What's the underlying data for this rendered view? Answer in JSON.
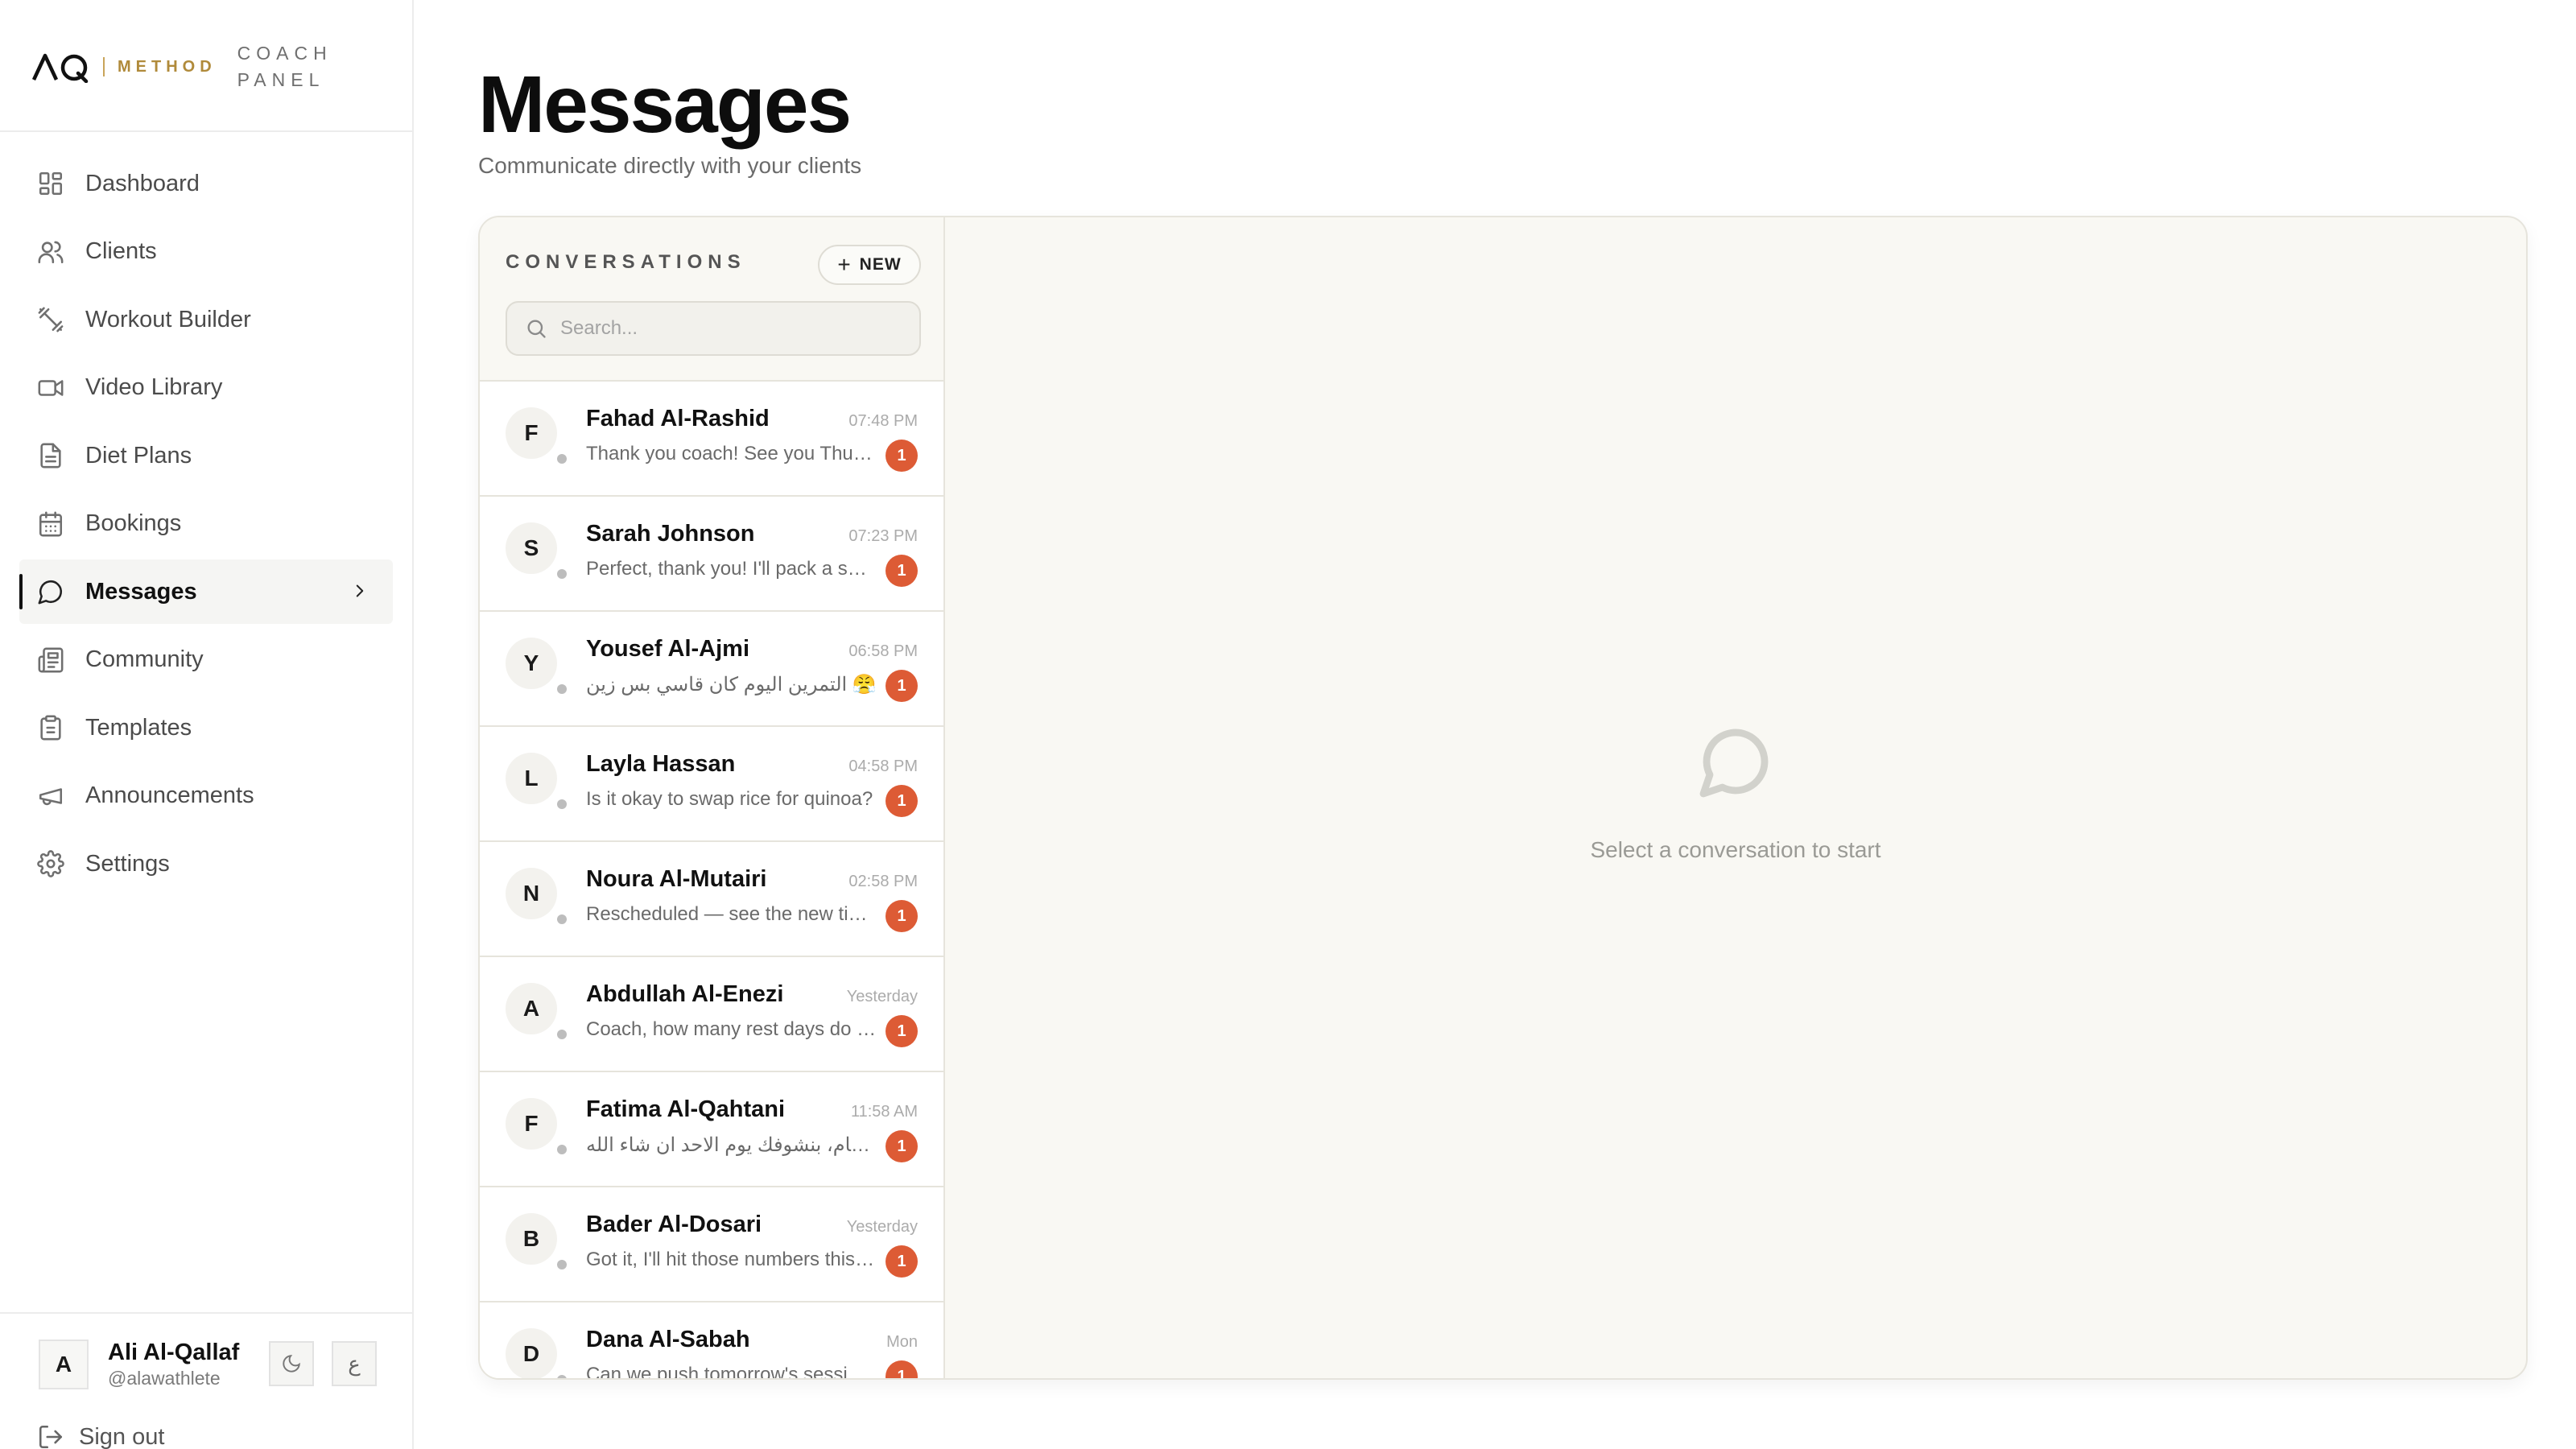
{
  "brand": {
    "logo": "AQ",
    "method": "METHOD",
    "panel": "COACH PANEL"
  },
  "nav": {
    "items": [
      {
        "label": "Dashboard",
        "icon": "dashboard-icon"
      },
      {
        "label": "Clients",
        "icon": "users-icon"
      },
      {
        "label": "Workout Builder",
        "icon": "dumbbell-icon"
      },
      {
        "label": "Video Library",
        "icon": "video-icon"
      },
      {
        "label": "Diet Plans",
        "icon": "file-text-icon"
      },
      {
        "label": "Bookings",
        "icon": "calendar-icon"
      },
      {
        "label": "Messages",
        "icon": "message-icon",
        "active": true
      },
      {
        "label": "Community",
        "icon": "newspaper-icon"
      },
      {
        "label": "Templates",
        "icon": "clipboard-icon"
      },
      {
        "label": "Announcements",
        "icon": "megaphone-icon"
      },
      {
        "label": "Settings",
        "icon": "gear-icon"
      }
    ]
  },
  "user": {
    "initial": "A",
    "name": "Ali Al-Qallaf",
    "handle": "@alawathlete",
    "theme_icon": "moon-icon",
    "lang_label": "ع"
  },
  "signout": {
    "label": "Sign out"
  },
  "page": {
    "title": "Messages",
    "subtitle": "Communicate directly with your clients"
  },
  "conversations": {
    "heading": "CONVERSATIONS",
    "new_label": "NEW",
    "search_placeholder": "Search...",
    "items": [
      {
        "initial": "F",
        "name": "Fahad Al-Rashid",
        "time": "07:48 PM",
        "preview": "Thank you coach! See you Thursday.",
        "unread": "1"
      },
      {
        "initial": "S",
        "name": "Sarah Johnson",
        "time": "07:23 PM",
        "preview": "Perfect, thank you! I'll pack a snack.",
        "unread": "1"
      },
      {
        "initial": "Y",
        "name": "Yousef Al-Ajmi",
        "time": "06:58 PM",
        "preview": "التمرين اليوم كان قاسي بس زين 😤",
        "unread": "1"
      },
      {
        "initial": "L",
        "name": "Layla Hassan",
        "time": "04:58 PM",
        "preview": "Is it okay to swap rice for quinoa?",
        "unread": "1"
      },
      {
        "initial": "N",
        "name": "Noura Al-Mutairi",
        "time": "02:58 PM",
        "preview": "Rescheduled — see the new time.",
        "unread": "1"
      },
      {
        "initial": "A",
        "name": "Abdullah Al-Enezi",
        "time": "Yesterday",
        "preview": "Coach, how many rest days do I need?",
        "unread": "1"
      },
      {
        "initial": "F",
        "name": "Fatima Al-Qahtani",
        "time": "11:58 AM",
        "preview": "ماشي تمام، بنشوفك يوم الاحد ان شاء الله",
        "unread": "1"
      },
      {
        "initial": "B",
        "name": "Bader Al-Dosari",
        "time": "Yesterday",
        "preview": "Got it, I'll hit those numbers this week.",
        "unread": "1"
      },
      {
        "initial": "D",
        "name": "Dana Al-Sabah",
        "time": "Mon",
        "preview": "Can we push tomorrow's session?",
        "unread": "1"
      }
    ]
  },
  "empty_state": {
    "text": "Select a conversation to start",
    "icon": "chat-bubble-icon"
  }
}
